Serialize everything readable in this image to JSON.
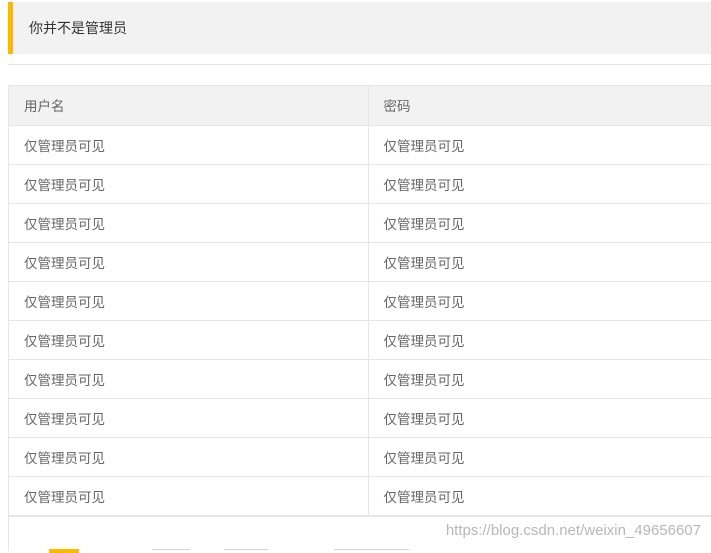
{
  "notice": {
    "text": "你并不是管理员"
  },
  "table": {
    "headers": [
      "用户名",
      "密码"
    ],
    "rows": [
      [
        "仅管理员可见",
        "仅管理员可见"
      ],
      [
        "仅管理员可见",
        "仅管理员可见"
      ],
      [
        "仅管理员可见",
        "仅管理员可见"
      ],
      [
        "仅管理员可见",
        "仅管理员可见"
      ],
      [
        "仅管理员可见",
        "仅管理员可见"
      ],
      [
        "仅管理员可见",
        "仅管理员可见"
      ],
      [
        "仅管理员可见",
        "仅管理员可见"
      ],
      [
        "仅管理员可见",
        "仅管理员可见"
      ],
      [
        "仅管理员可见",
        "仅管理员可见"
      ],
      [
        "仅管理员可见",
        "仅管理员可见"
      ]
    ]
  },
  "watermark": "https://blog.csdn.net/weixin_49656607",
  "colors": {
    "accent": "#FFB800",
    "header_bg": "#f2f2f2",
    "border": "#e6e6e6",
    "text": "#666666"
  }
}
